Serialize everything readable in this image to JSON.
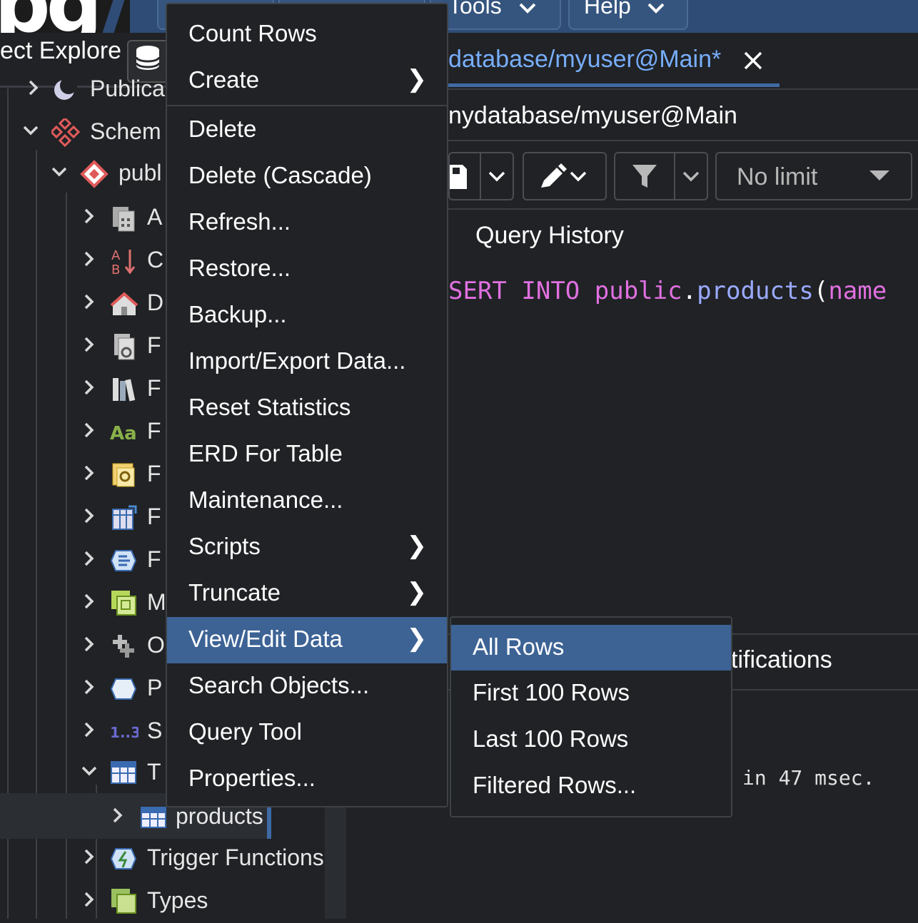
{
  "menubar": {
    "items": [
      {
        "label": "Tools"
      },
      {
        "label": "Help"
      }
    ]
  },
  "explorer": {
    "tab_label": "ect Explore"
  },
  "tree": {
    "rows": [
      {
        "label": "Publica",
        "icon": "publication-icon",
        "expanded": false
      },
      {
        "label": "Schem",
        "icon": "schemas-icon",
        "expanded": true
      },
      {
        "label": "publ",
        "icon": "schema-icon",
        "expanded": true
      },
      {
        "label": "A",
        "icon": "aggregates-icon",
        "expanded": false
      },
      {
        "label": "C",
        "icon": "collations-icon",
        "expanded": false
      },
      {
        "label": "D",
        "icon": "domains-icon",
        "expanded": false
      },
      {
        "label": "F",
        "icon": "fts-configurations-icon",
        "expanded": false
      },
      {
        "label": "F",
        "icon": "fts-dictionaries-icon",
        "expanded": false
      },
      {
        "label": "F",
        "icon": "fts-parsers-icon",
        "expanded": false
      },
      {
        "label": "F",
        "icon": "fts-templates-icon",
        "expanded": false
      },
      {
        "label": "F",
        "icon": "foreign-tables-icon",
        "expanded": false
      },
      {
        "label": "F",
        "icon": "functions-icon",
        "expanded": false
      },
      {
        "label": "M",
        "icon": "materialized-views-icon",
        "expanded": false
      },
      {
        "label": "O",
        "icon": "operators-icon",
        "expanded": false
      },
      {
        "label": "P",
        "icon": "procedures-icon",
        "expanded": false
      },
      {
        "label": "S",
        "icon": "sequences-icon",
        "expanded": false
      },
      {
        "label": "T",
        "icon": "tables-icon",
        "expanded": true
      },
      {
        "label": "products",
        "icon": "table-icon",
        "expanded": false
      },
      {
        "label": "Trigger Functions",
        "icon": "trigger-functions-icon",
        "expanded": false
      },
      {
        "label": "Types",
        "icon": "types-icon",
        "expanded": false
      }
    ]
  },
  "editor": {
    "tab_title": "database/myuser@Main*",
    "connection": "nydatabase/myuser@Main",
    "limit_select": "No limit",
    "history_tab": "Query History",
    "code": {
      "kw1": "SERT",
      "kw2": "INTO",
      "schema": "public",
      "dot": ".",
      "table": "products",
      "paren": "(",
      "col": "name"
    },
    "notifications_tab": "tifications",
    "message": "in 47 msec."
  },
  "context_menu": {
    "items": [
      {
        "label": "Count Rows",
        "submenu": false
      },
      {
        "label": "Create",
        "submenu": true
      },
      {
        "label": "Delete",
        "submenu": false
      },
      {
        "label": "Delete (Cascade)",
        "submenu": false
      },
      {
        "label": "Refresh...",
        "submenu": false
      },
      {
        "label": "Restore...",
        "submenu": false
      },
      {
        "label": "Backup...",
        "submenu": false
      },
      {
        "label": "Import/Export Data...",
        "submenu": false
      },
      {
        "label": "Reset Statistics",
        "submenu": false
      },
      {
        "label": "ERD For Table",
        "submenu": false
      },
      {
        "label": "Maintenance...",
        "submenu": false
      },
      {
        "label": "Scripts",
        "submenu": true
      },
      {
        "label": "Truncate",
        "submenu": true
      },
      {
        "label": "View/Edit Data",
        "submenu": true,
        "active": true
      },
      {
        "label": "Search Objects...",
        "submenu": false
      },
      {
        "label": "Query Tool",
        "submenu": false
      },
      {
        "label": "Properties...",
        "submenu": false
      }
    ],
    "arrow": "❯"
  },
  "submenu": {
    "items": [
      {
        "label": "All Rows",
        "active": true
      },
      {
        "label": "First 100 Rows"
      },
      {
        "label": "Last 100 Rows"
      },
      {
        "label": "Filtered Rows..."
      }
    ]
  },
  "colors": {
    "menubar": "#2f4c76",
    "accent": "#3d6395",
    "link": "#78aefc",
    "keyword": "#e070e0",
    "identifier": "#9aaaff"
  }
}
